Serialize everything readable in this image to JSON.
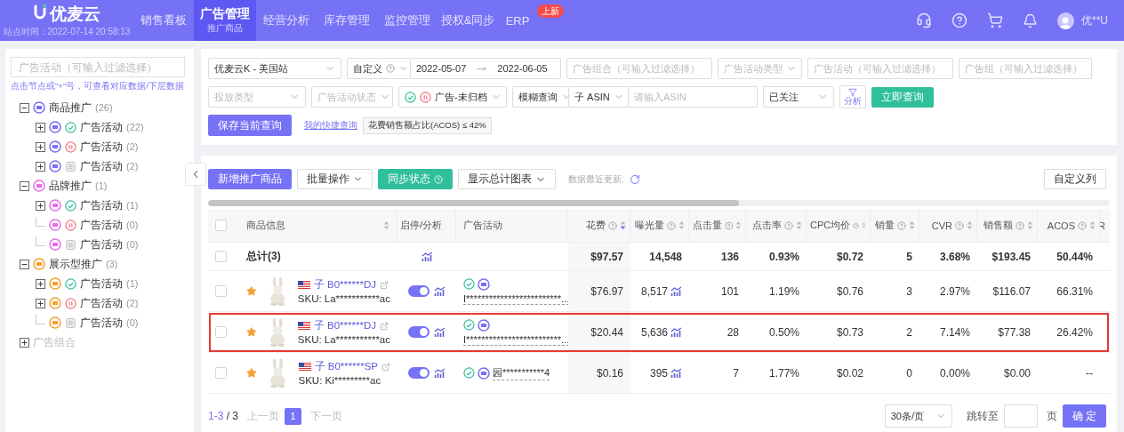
{
  "nav": {
    "logo": "优麦云",
    "station_time": "站点时间：2022-07-14 20:58:13",
    "items": [
      {
        "label": "销售看板",
        "selected": false
      },
      {
        "label": "广告管理",
        "sub": "推广商品",
        "selected": true
      },
      {
        "label": "经营分析",
        "selected": false
      },
      {
        "label": "库存管理",
        "selected": false
      },
      {
        "label": "监控管理",
        "selected": false
      },
      {
        "label": "授权&同步",
        "selected": false
      },
      {
        "label": "ERP",
        "badge": "上新",
        "selected": false
      }
    ],
    "user": "优**U"
  },
  "sidebar": {
    "search": {
      "placeholder": "广告活动（可输入过滤选择）"
    },
    "hint": "点击节点或\"+\"号，可查看对应数据/下层数据",
    "tree": [
      {
        "label": "商品推广",
        "count": "(26)",
        "color": "#7b6ff2",
        "expandable": true,
        "expanded": true,
        "children": [
          {
            "label": "广告活动",
            "count": "(22)",
            "kind": "enabled",
            "expandable": true,
            "expanded": false
          },
          {
            "label": "广告活动",
            "count": "(2)",
            "kind": "paused",
            "expandable": true,
            "expanded": false
          },
          {
            "label": "广告活动",
            "count": "(2)",
            "kind": "archived",
            "expandable": true,
            "expanded": false
          }
        ]
      },
      {
        "label": "品牌推广",
        "count": "(1)",
        "color": "#e86ee8",
        "expandable": true,
        "expanded": true,
        "children": [
          {
            "label": "广告活动",
            "count": "(1)",
            "kind": "enabled",
            "expandable": true,
            "expanded": false
          },
          {
            "label": "广告活动",
            "count": "(0)",
            "kind": "paused",
            "expandable": false
          },
          {
            "label": "广告活动",
            "count": "(0)",
            "kind": "archived",
            "expandable": false
          }
        ]
      },
      {
        "label": "展示型推广",
        "count": "(3)",
        "color": "#f5a030",
        "expandable": true,
        "expanded": true,
        "children": [
          {
            "label": "广告活动",
            "count": "(1)",
            "kind": "enabled",
            "expandable": true,
            "expanded": false
          },
          {
            "label": "广告活动",
            "count": "(2)",
            "kind": "paused",
            "expandable": true,
            "expanded": false
          },
          {
            "label": "广告活动",
            "count": "(0)",
            "kind": "archived",
            "expandable": false
          }
        ]
      },
      {
        "label": "广告组合",
        "expandable": true,
        "expanded": false,
        "disabled": true
      }
    ]
  },
  "filters": {
    "row1": [
      {
        "kind": "select",
        "value": "优麦云K - 美国站"
      },
      {
        "kind": "daterange",
        "mode": "自定义",
        "start": "2022-05-07",
        "end": "2022-06-05"
      },
      {
        "kind": "input",
        "placeholder": "广告组合（可输入过滤选择）"
      },
      {
        "kind": "select",
        "placeholder": "广告活动类型"
      },
      {
        "kind": "input",
        "placeholder": "广告活动（可输入过滤选择）"
      },
      {
        "kind": "input",
        "placeholder": "广告组（可输入过滤选择）"
      }
    ],
    "row2": [
      {
        "kind": "select",
        "placeholder": "投放类型"
      },
      {
        "kind": "select",
        "placeholder": "广告活动状态"
      },
      {
        "kind": "status",
        "value": "广告-未归档"
      },
      {
        "kind": "asin",
        "mode": "模糊查询",
        "type": "子 ASIN",
        "placeholder": "请输入ASIN"
      },
      {
        "kind": "select",
        "value": "已关注"
      }
    ],
    "analyze": "分析",
    "query": "立即查询",
    "save": "保存当前查询",
    "quick_link": "我的快捷查询",
    "quick_tag": "花费销售额占比(ACOS) ≤ 42%"
  },
  "toolbar": {
    "add": "新增推广商品",
    "batch": "批量操作",
    "sync": "同步状态",
    "chart": "显示总计图表",
    "updated": "数据最近更新:",
    "columns": "自定义列"
  },
  "table": {
    "all_checked": false,
    "columns": [
      {
        "label": "商品信息",
        "help": false,
        "sortable": true,
        "sorted": false
      },
      {
        "label": "启停/分析",
        "help": false,
        "sortable": false
      },
      {
        "label": "广告活动",
        "help": false,
        "sortable": false
      },
      {
        "label": "花费",
        "help": true,
        "sortable": true,
        "sorted": true
      },
      {
        "label": "曝光量",
        "help": true,
        "sortable": true,
        "sorted": false
      },
      {
        "label": "点击量",
        "help": true,
        "sortable": true,
        "sorted": false
      },
      {
        "label": "点击率",
        "help": true,
        "sortable": true,
        "sorted": false
      },
      {
        "label": "CPC均价",
        "help": true,
        "sortable": true,
        "sorted": false
      },
      {
        "label": "销量",
        "help": true,
        "sortable": true,
        "sorted": false
      },
      {
        "label": "CVR",
        "help": true,
        "sortable": true,
        "sorted": false
      },
      {
        "label": "销售额",
        "help": true,
        "sortable": true,
        "sorted": false
      },
      {
        "label": "ACOS",
        "help": true,
        "sortable": true,
        "sorted": false
      },
      {
        "label": "R"
      }
    ],
    "total": {
      "checked": false,
      "label": "总计(3)",
      "metrics": [
        "$97.57",
        "14,548",
        "136",
        "0.93%",
        "$0.72",
        "5",
        "3.68%",
        "$193.45",
        "50.44%"
      ]
    },
    "rows": [
      {
        "checked": false,
        "starred": true,
        "highlighted": false,
        "asin": "子 B0******DJ",
        "sku": "SKU: La***********ac",
        "on": true,
        "campaign_enabled": true,
        "campaign": "I*************************...",
        "metrics": [
          "$76.97",
          "8,517",
          "101",
          "1.19%",
          "$0.76",
          "3",
          "2.97%",
          "$116.07",
          "66.31%"
        ]
      },
      {
        "checked": false,
        "starred": true,
        "highlighted": true,
        "asin": "子 B0******DJ",
        "sku": "SKU: La***********ac",
        "on": true,
        "campaign_enabled": true,
        "campaign": "I*************************...",
        "metrics": [
          "$20.44",
          "5,636",
          "28",
          "0.50%",
          "$0.73",
          "2",
          "7.14%",
          "$77.38",
          "26.42%"
        ]
      },
      {
        "checked": false,
        "starred": true,
        "highlighted": false,
        "asin": "子 B0******SP",
        "sku": "SKU: Ki*********ac",
        "on": true,
        "campaign_enabled": true,
        "campaign": "园***********4",
        "metrics": [
          "$0.16",
          "395",
          "7",
          "1.77%",
          "$0.02",
          "0",
          "0.00%",
          "$0.00",
          "--"
        ]
      }
    ]
  },
  "pagination": {
    "range": "1-3",
    "total": "/ 3",
    "prev": "上一页",
    "pages": [
      {
        "label": "1",
        "selected": true
      }
    ],
    "next": "下一页",
    "size": "30条/页",
    "jump": "跳转至",
    "page_unit": "页",
    "confirm": "确 定"
  }
}
